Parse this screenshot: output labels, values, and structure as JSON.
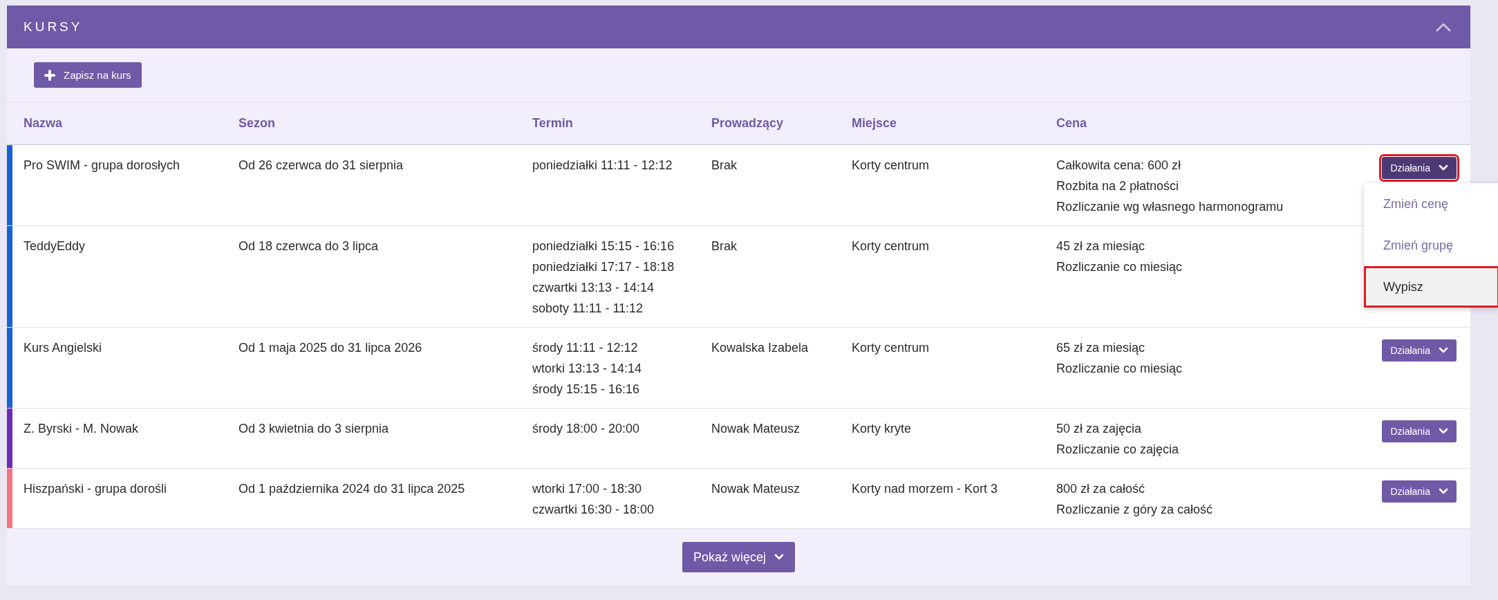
{
  "panel": {
    "title": "KURSY",
    "expanded": true
  },
  "toolbar": {
    "add_button": "Zapisz na kurs"
  },
  "table": {
    "columns": [
      "Nazwa",
      "Sezon",
      "Termin",
      "Prowadzący",
      "Miejsce",
      "Cena"
    ],
    "rows": [
      {
        "color": "#1a5fd6",
        "name": "Pro SWIM - grupa dorosłych",
        "season": "Od 26 czerwca do 31 sierpnia",
        "schedule": [
          "poniedziałki 11:11 - 12:12"
        ],
        "teacher": "Brak",
        "place": "Korty centrum",
        "price": [
          "Całkowita cena: 600 zł",
          "Rozbita na 2 płatności",
          "Rozliczanie wg własnego harmonogramu"
        ],
        "action": {
          "label": "Działania",
          "open": true,
          "highlighted": true,
          "menu": [
            {
              "label": "Zmień cenę",
              "highlighted": false
            },
            {
              "label": "Zmień grupę",
              "highlighted": false
            },
            {
              "label": "Wypisz",
              "highlighted": true
            }
          ]
        }
      },
      {
        "color": "#1a5fd6",
        "name": "TeddyEddy",
        "season": "Od 18 czerwca do 3 lipca",
        "schedule": [
          "poniedziałki 15:15 - 16:16",
          "poniedziałki 17:17 - 18:18",
          "czwartki 13:13 - 14:14",
          "soboty 11:11 - 11:12"
        ],
        "teacher": "Brak",
        "place": "Korty centrum",
        "price": [
          "45 zł za miesiąc",
          "Rozliczanie co miesiąc"
        ]
      },
      {
        "color": "#1a5fd6",
        "name": "Kurs Angielski",
        "season": "Od 1 maja 2025 do 31 lipca 2026",
        "schedule": [
          "środy 11:11 - 12:12",
          "wtorki 13:13 - 14:14",
          "środy 15:15 - 16:16"
        ],
        "teacher": "Kowalska Izabela",
        "place": "Korty centrum",
        "price": [
          "65 zł za miesiąc",
          "Rozliczanie co miesiąc"
        ],
        "action": {
          "label": "Działania",
          "open": false,
          "highlighted": false
        }
      },
      {
        "color": "#6a2fb0",
        "name": "Z. Byrski - M. Nowak",
        "season": "Od 3 kwietnia do 3 sierpnia",
        "schedule": [
          "środy 18:00 - 20:00"
        ],
        "teacher": "Nowak Mateusz",
        "place": "Korty kryte",
        "price": [
          "50 zł za zajęcia",
          "Rozliczanie co zajęcia"
        ],
        "action": {
          "label": "Działania",
          "open": false,
          "highlighted": false
        }
      },
      {
        "color": "#f07585",
        "name": "Hiszpański - grupa dorośli",
        "season": "Od 1 października 2024 do 31 lipca 2025",
        "schedule": [
          "wtorki 17:00 - 18:30",
          "czwartki 16:30 - 18:00"
        ],
        "teacher": "Nowak Mateusz",
        "place": "Korty nad morzem - Kort 3",
        "price": [
          "800 zł za całość",
          "Rozliczanie z góry za całość"
        ],
        "action": {
          "label": "Działania",
          "open": false,
          "highlighted": false
        }
      }
    ]
  },
  "footer": {
    "more_button": "Pokaż więcej"
  }
}
